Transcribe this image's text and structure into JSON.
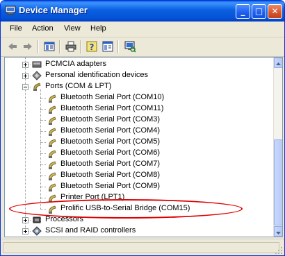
{
  "window": {
    "title": "Device Manager",
    "minimize": "_",
    "maximize": "□",
    "close": "✕"
  },
  "menu": [
    {
      "label": "File"
    },
    {
      "label": "Action"
    },
    {
      "label": "View"
    },
    {
      "label": "Help"
    }
  ],
  "tree": [
    {
      "label": "PCMCIA adapters",
      "icon": "pcmcia-icon",
      "level": 0,
      "expander": "plus"
    },
    {
      "label": "Personal identification devices",
      "icon": "id-device-icon",
      "level": 0,
      "expander": "plus"
    },
    {
      "label": "Ports (COM & LPT)",
      "icon": "ports-icon",
      "level": 0,
      "expander": "minus"
    },
    {
      "label": "Bluetooth Serial Port (COM10)",
      "icon": "port-connector-icon",
      "level": 1
    },
    {
      "label": "Bluetooth Serial Port (COM11)",
      "icon": "port-connector-icon",
      "level": 1
    },
    {
      "label": "Bluetooth Serial Port (COM3)",
      "icon": "port-connector-icon",
      "level": 1
    },
    {
      "label": "Bluetooth Serial Port (COM4)",
      "icon": "port-connector-icon",
      "level": 1
    },
    {
      "label": "Bluetooth Serial Port (COM5)",
      "icon": "port-connector-icon",
      "level": 1
    },
    {
      "label": "Bluetooth Serial Port (COM6)",
      "icon": "port-connector-icon",
      "level": 1
    },
    {
      "label": "Bluetooth Serial Port (COM7)",
      "icon": "port-connector-icon",
      "level": 1
    },
    {
      "label": "Bluetooth Serial Port (COM8)",
      "icon": "port-connector-icon",
      "level": 1
    },
    {
      "label": "Bluetooth Serial Port (COM9)",
      "icon": "port-connector-icon",
      "level": 1
    },
    {
      "label": "Printer Port (LPT1)",
      "icon": "port-connector-icon",
      "level": 1
    },
    {
      "label": "Prolific USB-to-Serial Bridge (COM15)",
      "icon": "port-connector-icon",
      "level": 1,
      "highlighted": true
    },
    {
      "label": "Processors",
      "icon": "processor-icon",
      "level": 0,
      "expander": "plus"
    },
    {
      "label": "SCSI and RAID controllers",
      "icon": "scsi-icon",
      "level": 0,
      "expander": "plus"
    }
  ],
  "toolbar_icons": [
    "back-arrow-icon",
    "forward-arrow-icon",
    "show-hide-tree-icon",
    "print-icon",
    "help-icon",
    "properties-icon",
    "scan-hardware-icon"
  ],
  "colors": {
    "title_bar": "#0a5fd8",
    "annotation": "#e00000",
    "selection_border": "#7f9db9"
  }
}
